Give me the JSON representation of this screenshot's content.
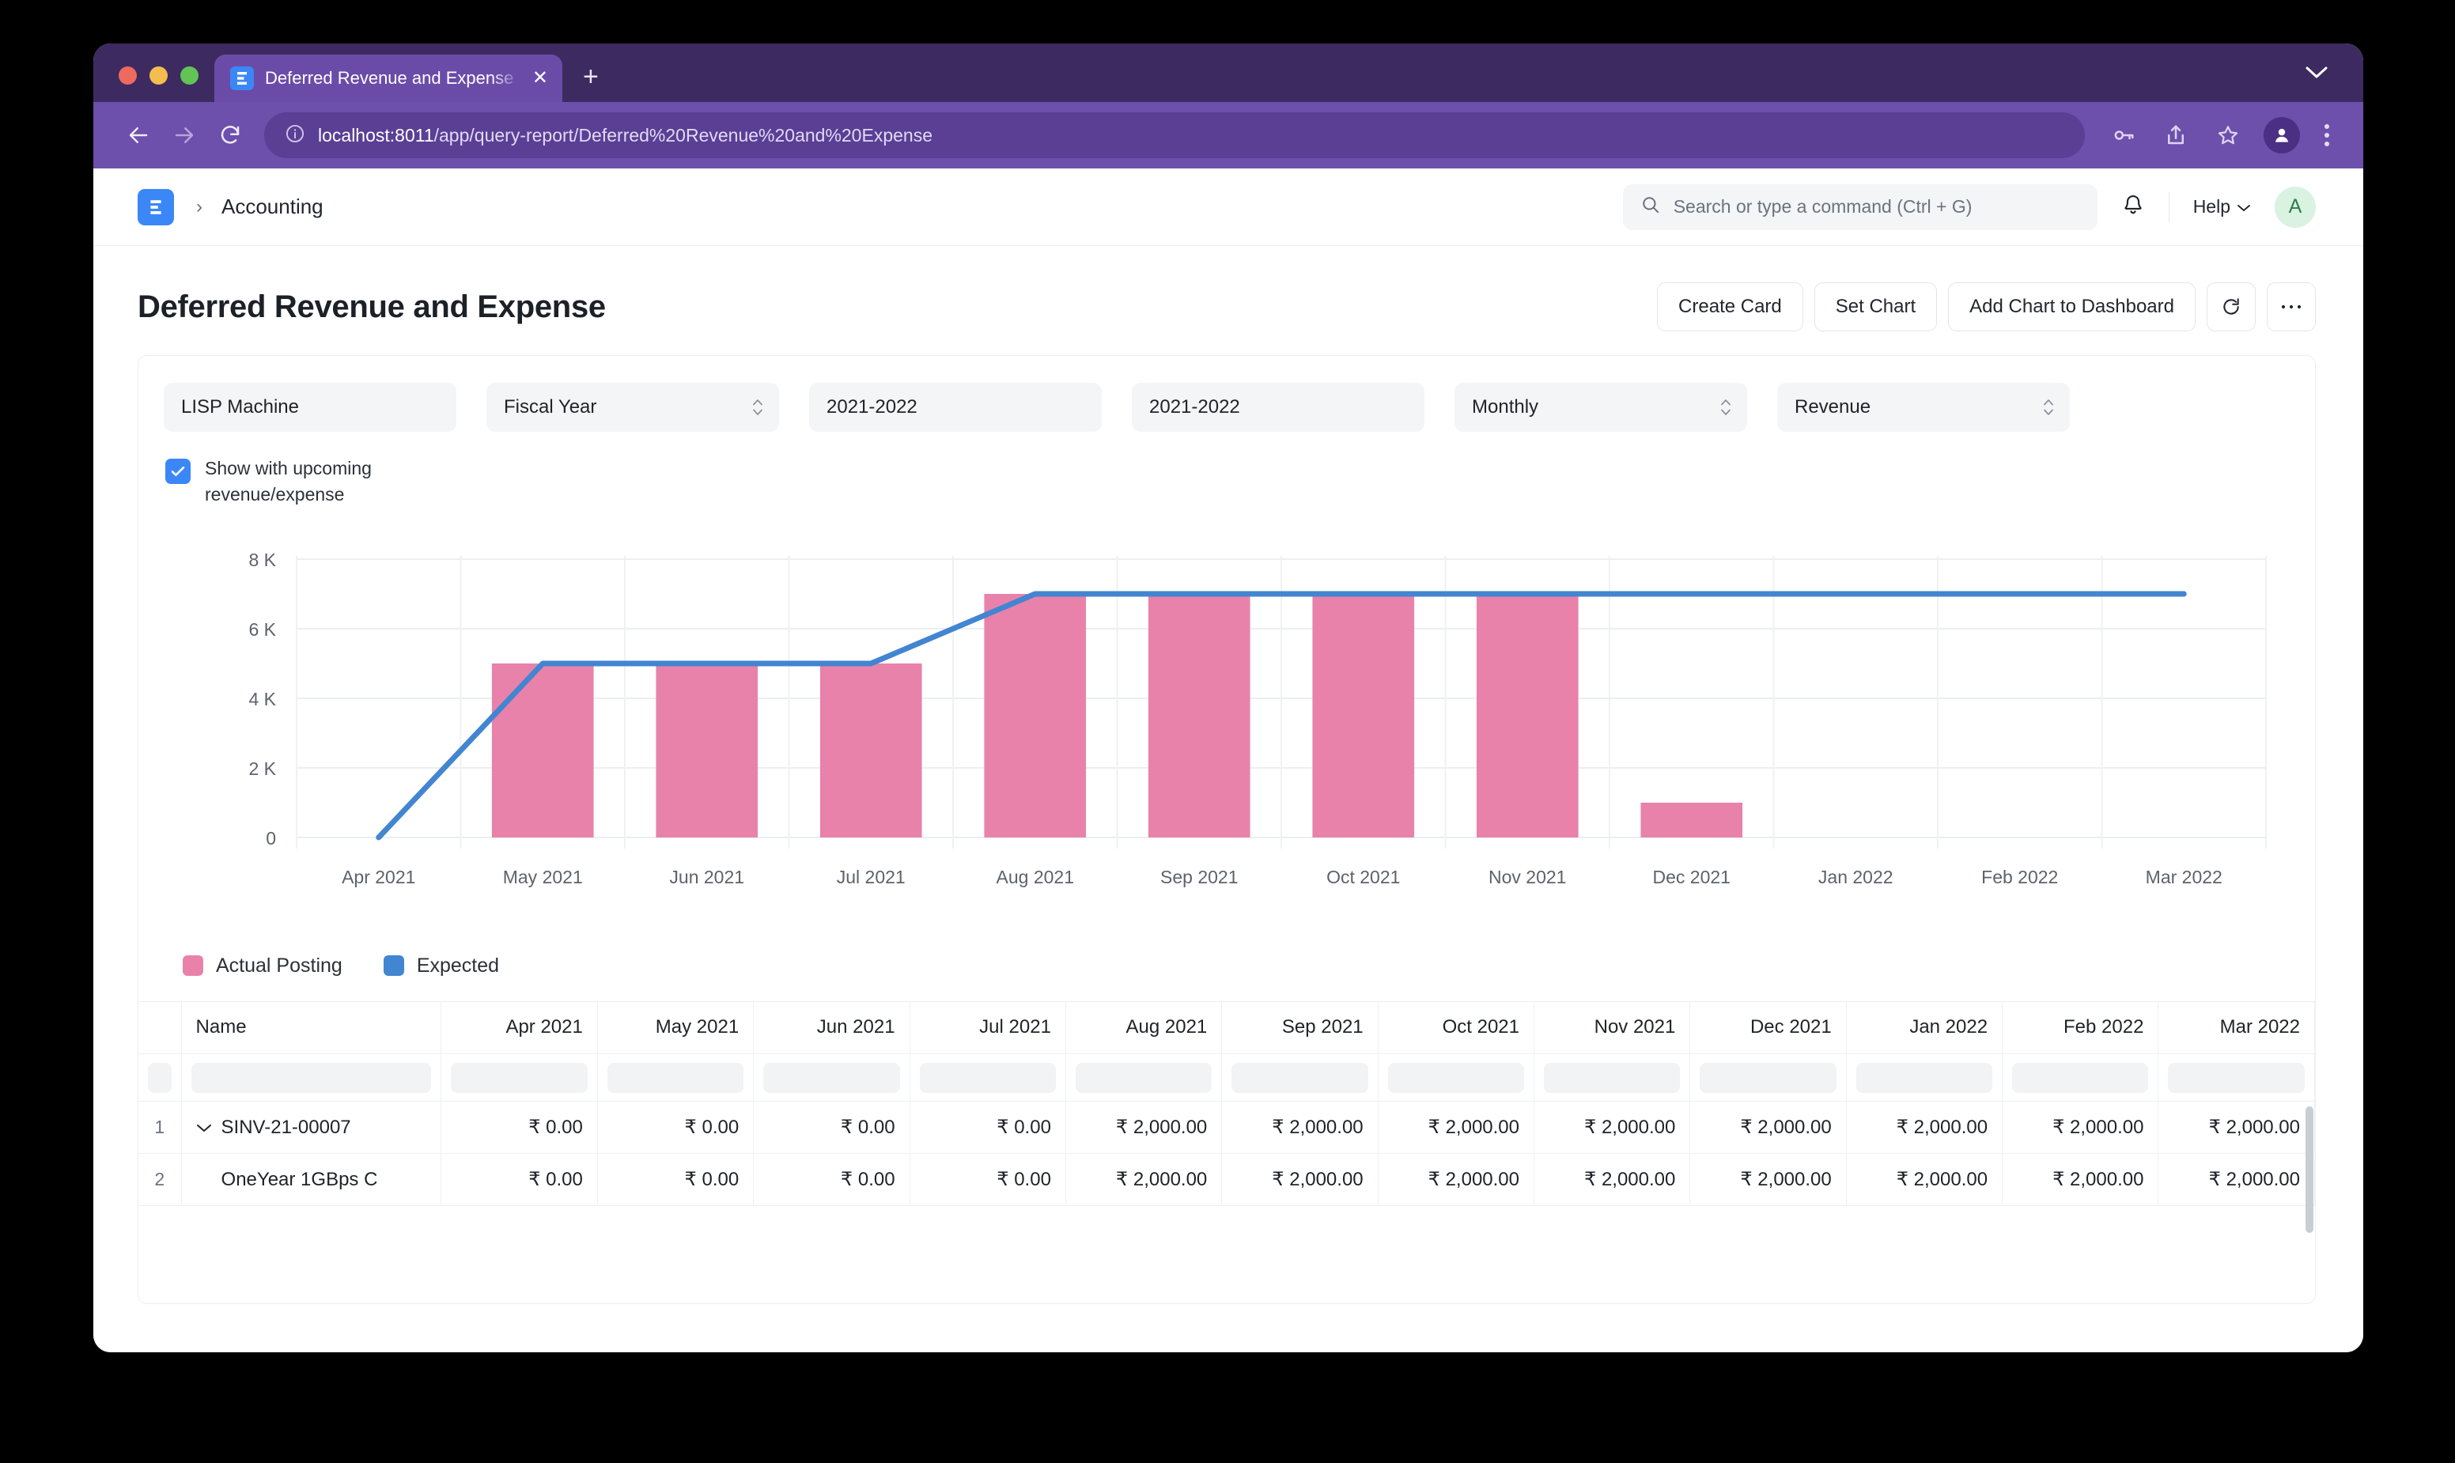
{
  "browser": {
    "tab_title": "Deferred Revenue and Expense",
    "tab_favicon": "erpnext-icon",
    "new_tab_label": "+",
    "close_label": "✕",
    "url_host": "localhost:8011",
    "url_path": "/app/query-report/Deferred%20Revenue%20and%20Expense",
    "back_icon": "arrow-left-icon",
    "forward_icon": "arrow-right-icon",
    "reload_icon": "reload-icon",
    "info_icon": "info-circle-icon",
    "password_icon": "key-icon",
    "share_icon": "share-icon",
    "bookmark_icon": "star-icon",
    "profile_icon": "person-icon",
    "menu_icon": "kebab-menu-icon",
    "window_chevron_icon": "chevron-down-icon"
  },
  "navbar": {
    "logo": "erpnext-logo",
    "breadcrumb_separator": "›",
    "breadcrumb": "Accounting",
    "search_placeholder": "Search or type a command (Ctrl + G)",
    "search_icon": "search-icon",
    "notification_icon": "bell-icon",
    "help_label": "Help",
    "help_chevron": "chevron-down-icon",
    "avatar_initial": "A"
  },
  "page": {
    "title": "Deferred Revenue and Expense",
    "actions": [
      {
        "label": "Create Card",
        "name": "create-card-button"
      },
      {
        "label": "Set Chart",
        "name": "set-chart-button"
      },
      {
        "label": "Add Chart to Dashboard",
        "name": "add-chart-to-dashboard-button"
      }
    ],
    "refresh_icon": "refresh-icon",
    "more_icon": "ellipsis-icon"
  },
  "filters": [
    {
      "name": "company-filter",
      "value": "LISP Machine",
      "has_spinner": false
    },
    {
      "name": "period-basis-filter",
      "value": "Fiscal Year",
      "has_spinner": true
    },
    {
      "name": "from-fiscal-year-filter",
      "value": "2021-2022",
      "has_spinner": false
    },
    {
      "name": "to-fiscal-year-filter",
      "value": "2021-2022",
      "has_spinner": false
    },
    {
      "name": "periodicity-filter",
      "value": "Monthly",
      "has_spinner": true
    },
    {
      "name": "type-filter",
      "value": "Revenue",
      "has_spinner": true
    }
  ],
  "checkbox": {
    "label": "Show with upcoming revenue/expense",
    "checked": true
  },
  "chart_data": {
    "type": "bar",
    "title": "",
    "xlabel": "",
    "ylabel": "",
    "categories": [
      "Apr 2021",
      "May 2021",
      "Jun 2021",
      "Jul 2021",
      "Aug 2021",
      "Sep 2021",
      "Oct 2021",
      "Nov 2021",
      "Dec 2021",
      "Jan 2022",
      "Feb 2022",
      "Mar 2022"
    ],
    "ylim": [
      0,
      8000
    ],
    "yticks": [
      0,
      2000,
      4000,
      6000,
      8000
    ],
    "ytick_labels": [
      "0",
      "2 K",
      "4 K",
      "6 K",
      "8 K"
    ],
    "grid": true,
    "legend_position": "bottom-left",
    "series": [
      {
        "name": "Actual Posting",
        "type": "bar",
        "color": "#e882ab",
        "values": [
          0,
          5000,
          5000,
          5000,
          7000,
          7000,
          7000,
          7000,
          1000,
          0,
          0,
          0
        ]
      },
      {
        "name": "Expected",
        "type": "line",
        "color": "#4285d1",
        "values": [
          0,
          5000,
          5000,
          5000,
          7000,
          7000,
          7000,
          7000,
          7000,
          7000,
          7000,
          7000
        ]
      }
    ]
  },
  "legend": [
    {
      "label": "Actual Posting",
      "color": "#e882ab"
    },
    {
      "label": "Expected",
      "color": "#4285d1"
    }
  ],
  "table": {
    "columns": [
      "Name",
      "Apr 2021",
      "May 2021",
      "Jun 2021",
      "Jul 2021",
      "Aug 2021",
      "Sep 2021",
      "Oct 2021",
      "Nov 2021",
      "Dec 2021",
      "Jan 2022",
      "Feb 2022",
      "Mar 2022"
    ],
    "rows": [
      {
        "index": "1",
        "expandable": true,
        "expand_icon": "chevron-down-icon",
        "name": "SINV-21-00007",
        "values": [
          "₹ 0.00",
          "₹ 0.00",
          "₹ 0.00",
          "₹ 0.00",
          "₹ 2,000.00",
          "₹ 2,000.00",
          "₹ 2,000.00",
          "₹ 2,000.00",
          "₹ 2,000.00",
          "₹ 2,000.00",
          "₹ 2,000.00",
          "₹ 2,000.00"
        ]
      },
      {
        "index": "2",
        "expandable": false,
        "expand_icon": "",
        "name": "OneYear 1GBps C",
        "values": [
          "₹ 0.00",
          "₹ 0.00",
          "₹ 0.00",
          "₹ 0.00",
          "₹ 2,000.00",
          "₹ 2,000.00",
          "₹ 2,000.00",
          "₹ 2,000.00",
          "₹ 2,000.00",
          "₹ 2,000.00",
          "₹ 2,000.00",
          "₹ 2,000.00"
        ]
      }
    ]
  }
}
